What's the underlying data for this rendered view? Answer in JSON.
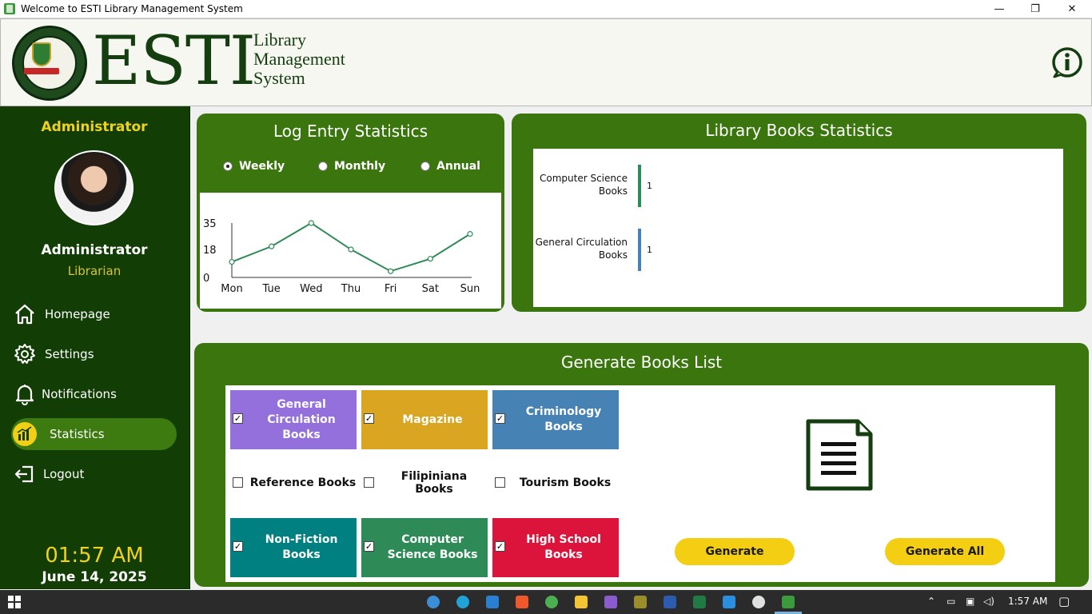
{
  "window": {
    "title": "Welcome to ESTI Library Management System",
    "minimize": "—",
    "restore": "❐",
    "close": "✕"
  },
  "header": {
    "logo": "ESTI",
    "subtitle_line1": "Library",
    "subtitle_line2": "Management",
    "subtitle_line3": "System",
    "seal_text": "ERHARD SYSTEMS TECHNOLOGICAL INSTITUTE · ODIONGAN, ROMBLON"
  },
  "sidebar": {
    "role": "Administrator",
    "name": "Administrator",
    "position": "Librarian",
    "items": [
      {
        "label": "Homepage",
        "icon": "home-icon"
      },
      {
        "label": "Settings",
        "icon": "gear-icon"
      },
      {
        "label": "Notifications",
        "icon": "bell-icon"
      },
      {
        "label": "Statistics",
        "icon": "chart-icon",
        "active": true
      },
      {
        "label": "Logout",
        "icon": "logout-icon"
      }
    ],
    "time": "01:57 AM",
    "date": "June 14, 2025"
  },
  "log_stats": {
    "title": "Log Entry Statistics",
    "options": [
      "Weekly",
      "Monthly",
      "Annual"
    ],
    "selected": "Weekly"
  },
  "library_stats": {
    "title": "Library Books Statistics"
  },
  "generate": {
    "title": "Generate Books List",
    "tiles": [
      {
        "label": "General Circulation Books",
        "color": "#9370db",
        "checked": true
      },
      {
        "label": "Magazine",
        "color": "#daa520",
        "checked": true
      },
      {
        "label": "Criminology Books",
        "color": "#4682b4",
        "checked": true
      },
      {
        "label": "Reference Books",
        "color": "",
        "checked": false
      },
      {
        "label": "Filipiniana Books",
        "color": "",
        "checked": false
      },
      {
        "label": "Tourism Books",
        "color": "",
        "checked": false
      },
      {
        "label": "Non-Fiction Books",
        "color": "#008080",
        "checked": true
      },
      {
        "label": "Computer Science Books",
        "color": "#2e8b57",
        "checked": true
      },
      {
        "label": "High School Books",
        "color": "#dc143c",
        "checked": true
      }
    ],
    "generate_label": "Generate",
    "generate_all_label": "Generate All"
  },
  "taskbar": {
    "time": "1:57 AM"
  },
  "chart_data": [
    {
      "type": "line",
      "categories": [
        "Mon",
        "Tue",
        "Wed",
        "Thu",
        "Fri",
        "Sat",
        "Sun"
      ],
      "values": [
        10,
        20,
        35,
        18,
        4,
        12,
        28
      ],
      "yticks": [
        0,
        18,
        35
      ],
      "ylim": [
        0,
        35
      ],
      "color": "#2e8b57"
    },
    {
      "type": "bar",
      "orientation": "horizontal",
      "categories": [
        "Computer Science Books",
        "General Circulation Books"
      ],
      "values": [
        1,
        1
      ],
      "colors": [
        "#2e8b57",
        "#4682b4"
      ]
    }
  ]
}
